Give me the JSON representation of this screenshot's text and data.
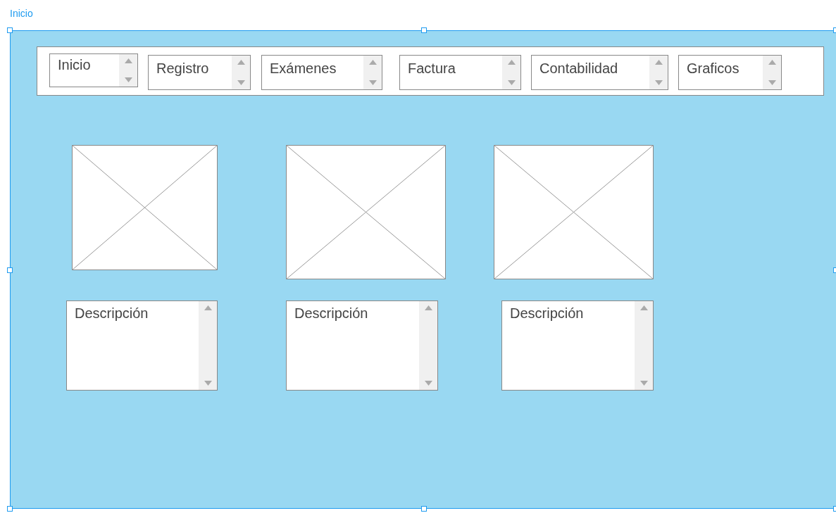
{
  "selection_label": "Inicio",
  "nav_fields": [
    {
      "value": "Inicio"
    },
    {
      "value": "Registro"
    },
    {
      "value": "Exámenes"
    },
    {
      "value": "Factura"
    },
    {
      "value": "Contabilidad"
    },
    {
      "value": "Graficos"
    }
  ],
  "cards": [
    {
      "description": "Descripción"
    },
    {
      "description": "Descripción"
    },
    {
      "description": "Descripción"
    }
  ]
}
